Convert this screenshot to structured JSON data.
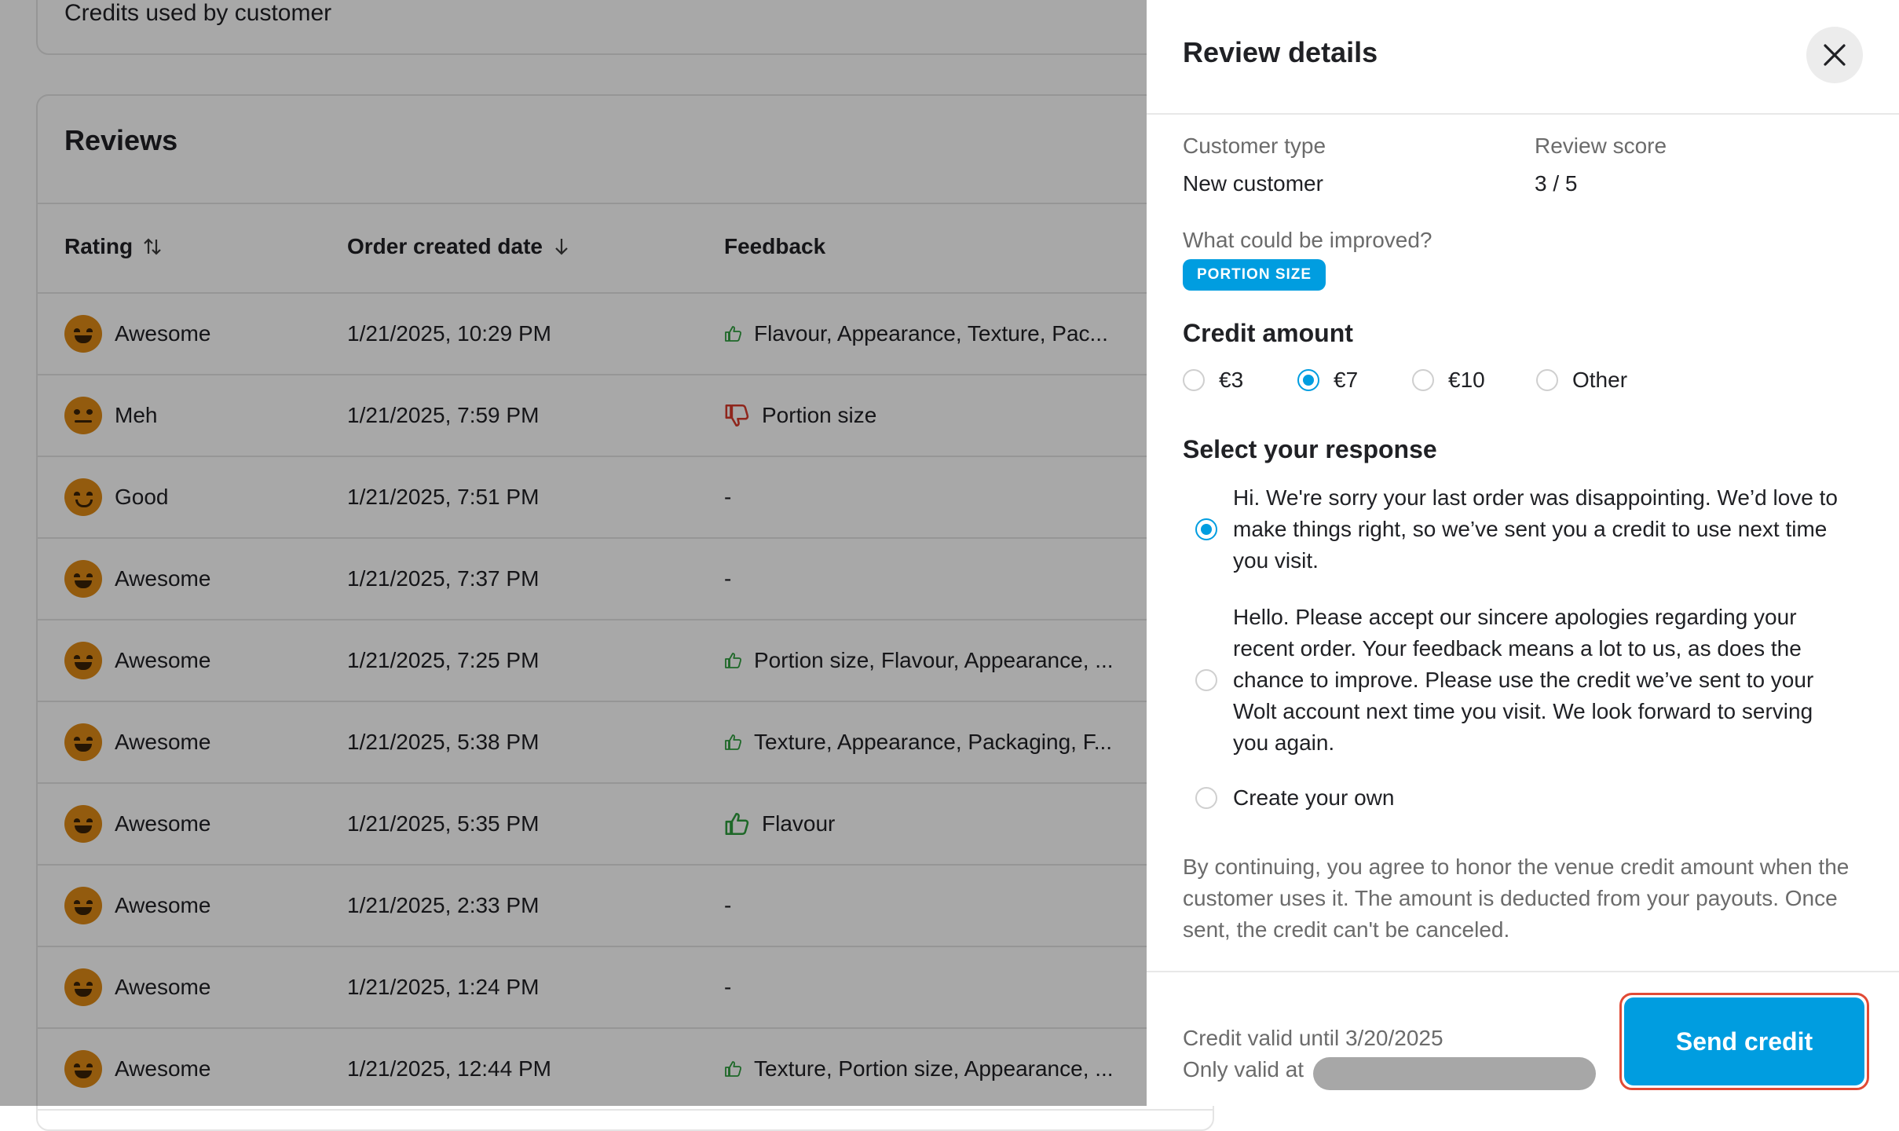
{
  "background": {
    "top_card_title": "Credits used by customer",
    "reviews": {
      "title": "Reviews",
      "columns": {
        "rating": "Rating",
        "order_date": "Order created date",
        "feedback": "Feedback"
      },
      "rows": [
        {
          "rating": "Awesome",
          "mood": "awesome",
          "date": "1/21/2025, 10:29 PM",
          "feedback": "Flavour, Appearance, Texture, Pac...",
          "sentiment": "positive"
        },
        {
          "rating": "Meh",
          "mood": "meh",
          "date": "1/21/2025, 7:59 PM",
          "feedback": "Portion size",
          "sentiment": "negative"
        },
        {
          "rating": "Good",
          "mood": "good",
          "date": "1/21/2025, 7:51 PM",
          "feedback": "-",
          "sentiment": "none"
        },
        {
          "rating": "Awesome",
          "mood": "awesome",
          "date": "1/21/2025, 7:37 PM",
          "feedback": "-",
          "sentiment": "none"
        },
        {
          "rating": "Awesome",
          "mood": "awesome",
          "date": "1/21/2025, 7:25 PM",
          "feedback": "Portion size, Flavour, Appearance, ...",
          "sentiment": "positive"
        },
        {
          "rating": "Awesome",
          "mood": "awesome",
          "date": "1/21/2025, 5:38 PM",
          "feedback": "Texture, Appearance, Packaging, F...",
          "sentiment": "positive"
        },
        {
          "rating": "Awesome",
          "mood": "awesome",
          "date": "1/21/2025, 5:35 PM",
          "feedback": "Flavour",
          "sentiment": "positive"
        },
        {
          "rating": "Awesome",
          "mood": "awesome",
          "date": "1/21/2025, 2:33 PM",
          "feedback": "-",
          "sentiment": "none"
        },
        {
          "rating": "Awesome",
          "mood": "awesome",
          "date": "1/21/2025, 1:24 PM",
          "feedback": "-",
          "sentiment": "none"
        },
        {
          "rating": "Awesome",
          "mood": "awesome",
          "date": "1/21/2025, 12:44 PM",
          "feedback": "Texture, Portion size, Appearance, ...",
          "sentiment": "positive"
        }
      ]
    }
  },
  "drawer": {
    "title": "Review details",
    "customer_type_label": "Customer type",
    "customer_type_value": "New customer",
    "review_score_label": "Review score",
    "review_score_value": "3 / 5",
    "improve_label": "What could be improved?",
    "improve_chip": "PORTION SIZE",
    "credit_amount_title": "Credit amount",
    "credit_options": [
      {
        "label": "€3",
        "checked": false
      },
      {
        "label": "€7",
        "checked": true
      },
      {
        "label": "€10",
        "checked": false
      },
      {
        "label": "Other",
        "checked": false
      }
    ],
    "response_title": "Select your response",
    "responses": [
      {
        "text": "Hi. We're sorry your last order was disappointing. We’d love to make things right, so we’ve sent you a credit to use next time you visit.",
        "checked": true
      },
      {
        "text": "Hello. Please accept our sincere apologies regarding your recent order. Your feedback means a lot to us, as does the chance to improve. Please use the credit we’ve sent to your Wolt account next time you visit. We look forward to serving you again.",
        "checked": false
      },
      {
        "text": "Create your own",
        "checked": false
      }
    ],
    "disclaimer": "By continuing, you agree to honor the venue credit amount when the customer uses it. The amount is deducted from your payouts. Once sent, the credit can't be canceled.",
    "valid_until": "Credit valid until 3/20/2025",
    "valid_at": "Only valid at",
    "send_button": "Send credit"
  },
  "colors": {
    "accent": "#009de0",
    "positive": "#2e9e3e",
    "negative": "#d93a2b",
    "highlight": "#e14a35"
  },
  "icons": {
    "close": "close-icon",
    "sort_both": "sort-both-icon",
    "sort_down": "arrow-down-icon",
    "positive": "thumbs-up-icon",
    "negative": "thumbs-down-icon"
  }
}
